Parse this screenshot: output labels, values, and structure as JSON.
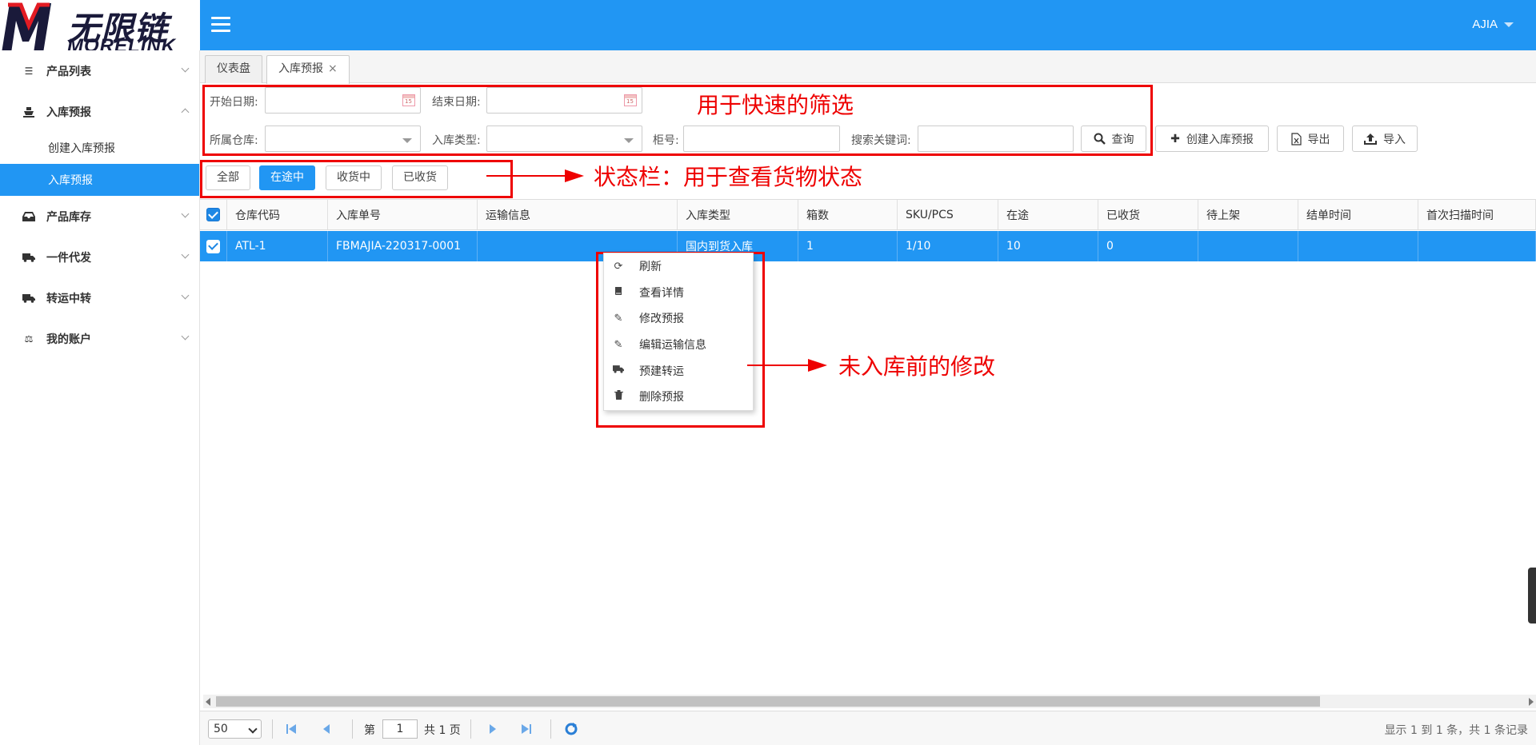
{
  "header": {
    "logo_cn": "无限链接",
    "logo_en": "MORELINK",
    "user": "AJIA"
  },
  "sidebar": {
    "items": [
      {
        "label": "产品列表",
        "icon": "list-icon"
      },
      {
        "label": "入库预报",
        "icon": "ship-icon",
        "children": [
          "创建入库预报",
          "入库预报"
        ]
      },
      {
        "label": "产品库存",
        "icon": "inbox-icon"
      },
      {
        "label": "一件代发",
        "icon": "truck-icon"
      },
      {
        "label": "转运中转",
        "icon": "truck-icon"
      },
      {
        "label": "我的账户",
        "icon": "balance-scale-icon"
      }
    ]
  },
  "tabs": [
    "仪表盘",
    "入库预报"
  ],
  "filters": {
    "start_date": "开始日期:",
    "end_date": "结束日期:",
    "warehouse": "所属仓库:",
    "inbound_type": "入库类型:",
    "container_no": "柜号:",
    "keyword": "搜索关键词:",
    "search_btn": "查询",
    "create_btn": "创建入库预报",
    "export_btn": "导出",
    "import_btn": "导入"
  },
  "status_buttons": [
    "全部",
    "在途中",
    "收货中",
    "已收货"
  ],
  "annotations": {
    "filter": "用于快速的筛选",
    "status": "状态栏：用于查看货物状态",
    "menu": "未入库前的修改"
  },
  "table": {
    "columns": [
      "仓库代码",
      "入库单号",
      "运输信息",
      "入库类型",
      "箱数",
      "SKU/PCS",
      "在途",
      "已收货",
      "待上架",
      "结单时间",
      "首次扫描时间"
    ],
    "rows": [
      [
        "ATL-1",
        "FBMAJIA-220317-0001",
        "",
        "国内到货入库",
        "1",
        "1/10",
        "10",
        "0",
        "",
        "",
        ""
      ]
    ]
  },
  "context_menu": [
    {
      "label": "刷新",
      "icon": "refresh-icon"
    },
    {
      "label": "查看详情",
      "icon": "book-icon"
    },
    {
      "label": "修改预报",
      "icon": "pencil-icon"
    },
    {
      "label": "编辑运输信息",
      "icon": "pencil-icon"
    },
    {
      "label": "预建转运",
      "icon": "truck-icon"
    },
    {
      "label": "删除预报",
      "icon": "trash-icon"
    }
  ],
  "pager": {
    "page_size": "50",
    "page_prefix": "第",
    "page": "1",
    "page_suffix": "共 1 页",
    "info": "显示 1 到 1 条，共 1 条记录"
  },
  "colors": {
    "primary": "#2196f3",
    "annotation": "#e00000"
  }
}
